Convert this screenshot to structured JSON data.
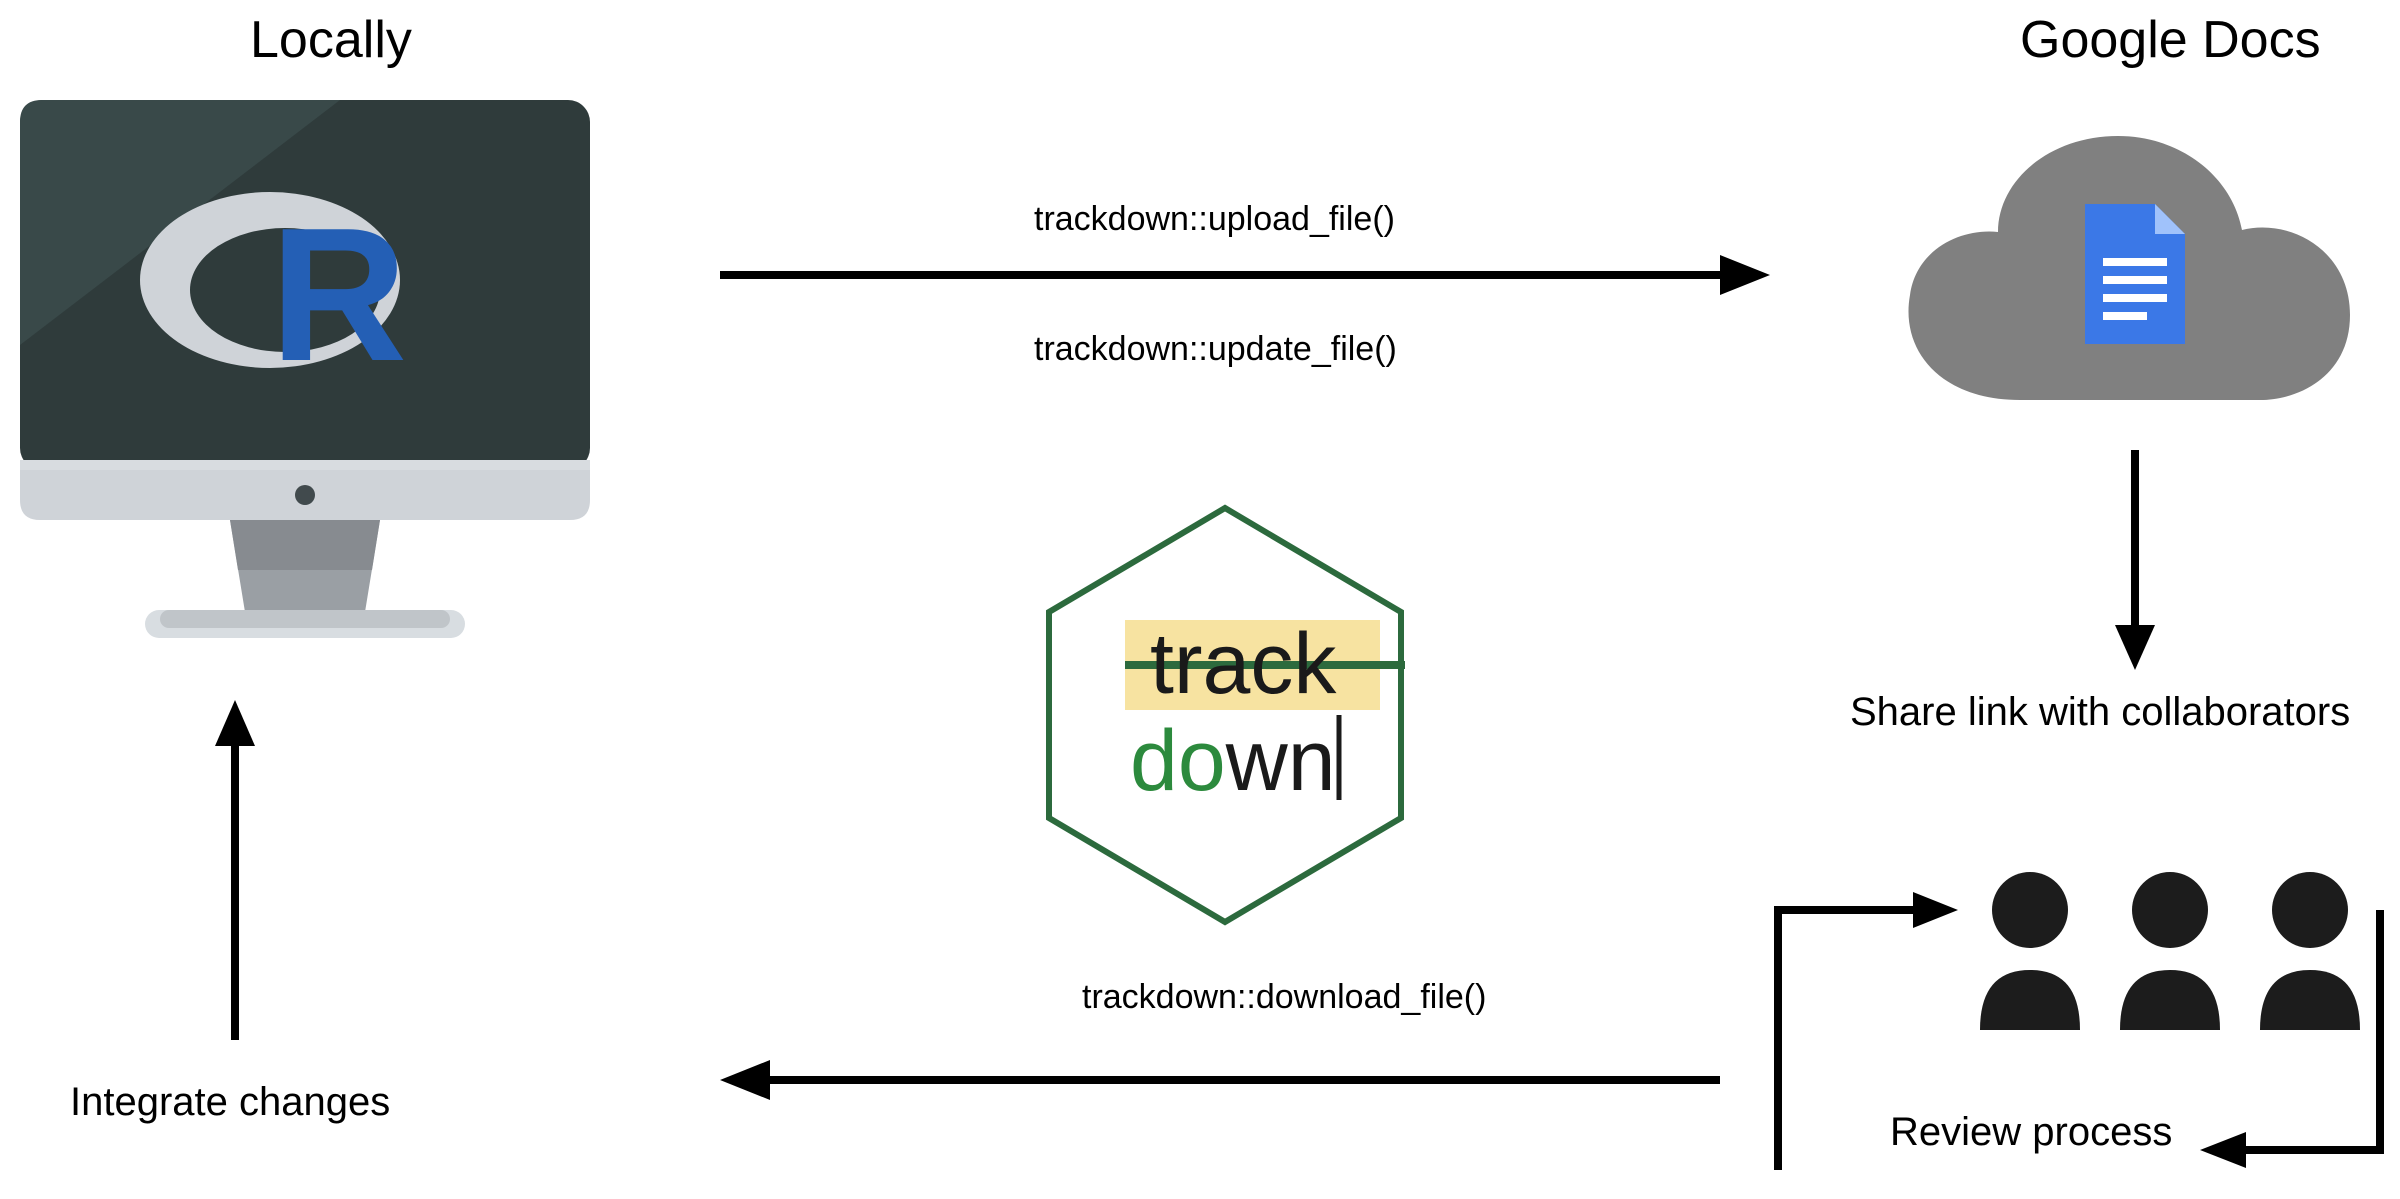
{
  "left_heading": "Locally",
  "right_heading": "Google Docs",
  "arrow_top_label1": "trackdown::upload_file()",
  "arrow_top_label2": "trackdown::update_file()",
  "share_label": "Share link with collaborators",
  "review_label": "Review process",
  "arrow_bottom_label": "trackdown::download_file()",
  "integrate_label": "Integrate changes",
  "hex_text_top": "track",
  "hex_text_bottom_left": "do",
  "hex_text_bottom_right": "wn",
  "logo_letter": "R"
}
